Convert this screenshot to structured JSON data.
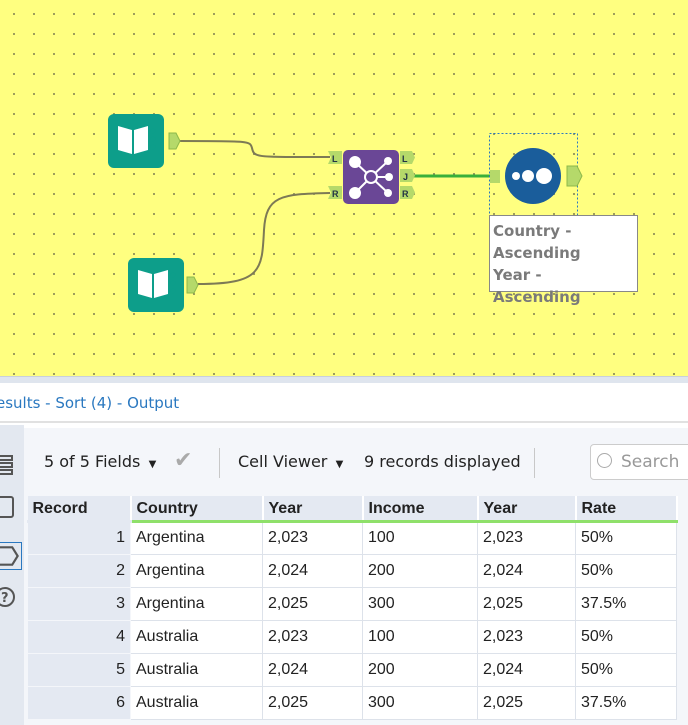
{
  "canvas": {
    "tools": [
      {
        "name": "Input Data 1",
        "icon": "book-icon"
      },
      {
        "name": "Input Data 2",
        "icon": "book-icon"
      },
      {
        "name": "Join",
        "icon": "join-icon",
        "anchors_in": [
          "L",
          "R"
        ],
        "anchors_out": [
          "L",
          "J",
          "R"
        ]
      },
      {
        "name": "Sort",
        "icon": "sort-icon"
      }
    ],
    "annotation": [
      "Country -",
      "Ascending",
      "Year - Ascending"
    ],
    "colors": {
      "background": "#ffff80",
      "input": "#0d9e8a",
      "join": "#6a4796",
      "sort": "#1a5d9b",
      "connection_active": "#3ab03a"
    }
  },
  "results": {
    "title": "esults - Sort (4) - Output",
    "fields_label": "5 of 5 Fields",
    "viewer_label": "Cell Viewer",
    "records_label": "9 records displayed",
    "search_placeholder": "Search",
    "columns": [
      "Record",
      "Country",
      "Year",
      "Income",
      "Year",
      "Rate"
    ],
    "rows": [
      [
        "1",
        "Argentina",
        "2,023",
        "100",
        "2,023",
        "50%"
      ],
      [
        "2",
        "Argentina",
        "2,024",
        "200",
        "2,024",
        "50%"
      ],
      [
        "3",
        "Argentina",
        "2,025",
        "300",
        "2,025",
        "37.5%"
      ],
      [
        "4",
        "Australia",
        "2,023",
        "100",
        "2,023",
        "50%"
      ],
      [
        "5",
        "Australia",
        "2,024",
        "200",
        "2,024",
        "50%"
      ],
      [
        "6",
        "Australia",
        "2,025",
        "300",
        "2,025",
        "37.5%"
      ]
    ]
  }
}
